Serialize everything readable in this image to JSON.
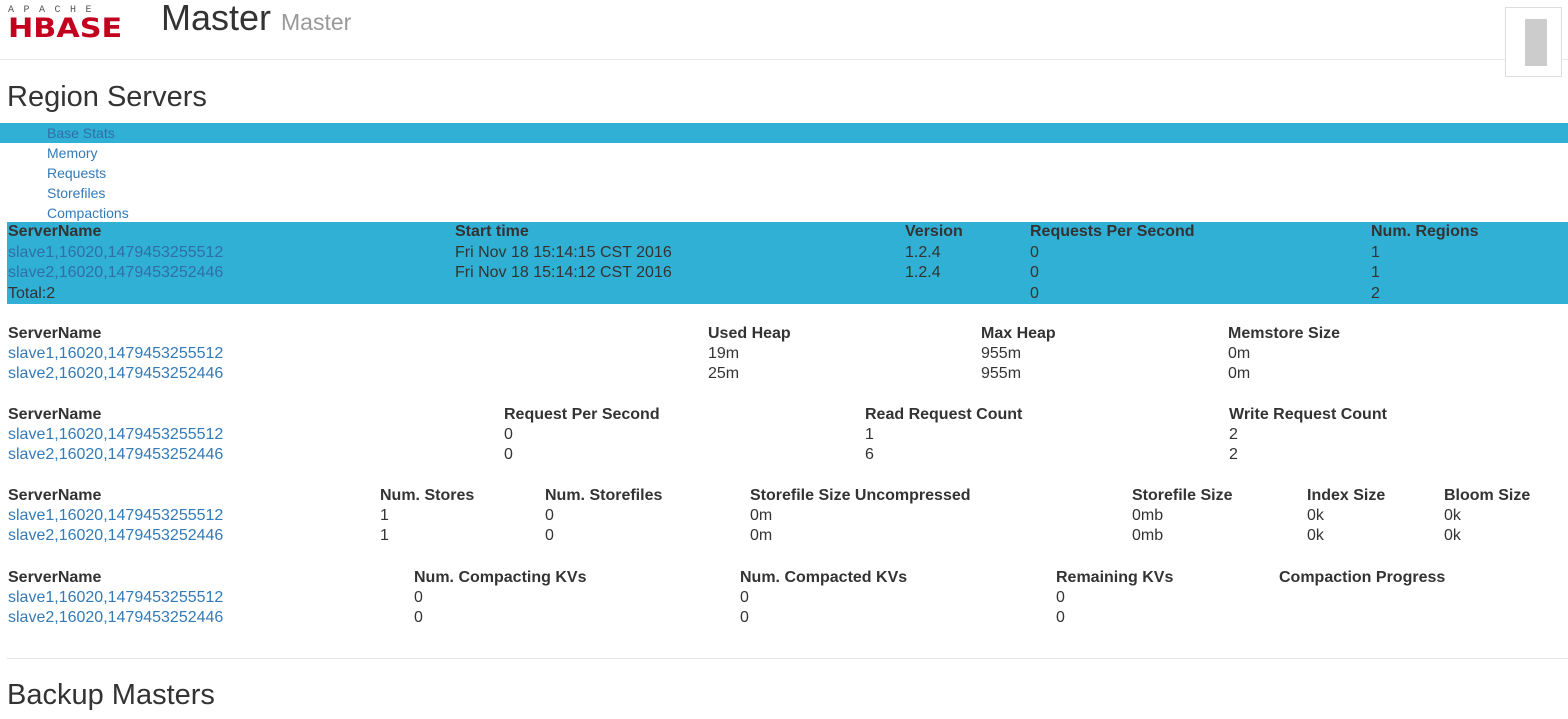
{
  "header": {
    "logo_top": "APACHE",
    "logo_main": "HBASE",
    "title": "Master",
    "subtitle": "Master"
  },
  "region_servers": {
    "title": "Region Servers",
    "tabs": [
      {
        "label": "Base Stats",
        "active": true
      },
      {
        "label": "Memory",
        "active": false
      },
      {
        "label": "Requests",
        "active": false
      },
      {
        "label": "Storefiles",
        "active": false
      },
      {
        "label": "Compactions",
        "active": false
      }
    ],
    "base_stats": {
      "headers": [
        "ServerName",
        "Start time",
        "Version",
        "Requests Per Second",
        "Num. Regions"
      ],
      "rows": [
        [
          "slave1,16020,1479453255512",
          "Fri Nov 18 15:14:15 CST 2016",
          "1.2.4",
          "0",
          "1"
        ],
        [
          "slave2,16020,1479453252446",
          "Fri Nov 18 15:14:12 CST 2016",
          "1.2.4",
          "0",
          "1"
        ]
      ],
      "total": [
        "Total:2",
        "",
        "",
        "0",
        "2"
      ]
    },
    "memory": {
      "headers": [
        "ServerName",
        "Used Heap",
        "Max Heap",
        "Memstore Size"
      ],
      "rows": [
        [
          "slave1,16020,1479453255512",
          "19m",
          "955m",
          "0m"
        ],
        [
          "slave2,16020,1479453252446",
          "25m",
          "955m",
          "0m"
        ]
      ]
    },
    "requests": {
      "headers": [
        "ServerName",
        "Request Per Second",
        "Read Request Count",
        "Write Request Count"
      ],
      "rows": [
        [
          "slave1,16020,1479453255512",
          "0",
          "1",
          "2"
        ],
        [
          "slave2,16020,1479453252446",
          "0",
          "6",
          "2"
        ]
      ]
    },
    "storefiles": {
      "headers": [
        "ServerName",
        "Num. Stores",
        "Num. Storefiles",
        "Storefile Size Uncompressed",
        "Storefile Size",
        "Index Size",
        "Bloom Size"
      ],
      "rows": [
        [
          "slave1,16020,1479453255512",
          "1",
          "0",
          "0m",
          "0mb",
          "0k",
          "0k"
        ],
        [
          "slave2,16020,1479453252446",
          "1",
          "0",
          "0m",
          "0mb",
          "0k",
          "0k"
        ]
      ]
    },
    "compactions": {
      "headers": [
        "ServerName",
        "Num. Compacting KVs",
        "Num. Compacted KVs",
        "Remaining KVs",
        "Compaction Progress"
      ],
      "rows": [
        [
          "slave1,16020,1479453255512",
          "0",
          "0",
          "0",
          ""
        ],
        [
          "slave2,16020,1479453252446",
          "0",
          "0",
          "0",
          ""
        ]
      ]
    }
  },
  "backup_masters": {
    "title": "Backup Masters"
  },
  "colors": {
    "accent": "#31b0d5",
    "link": "#337ab7",
    "logo_red": "#c4001f"
  }
}
